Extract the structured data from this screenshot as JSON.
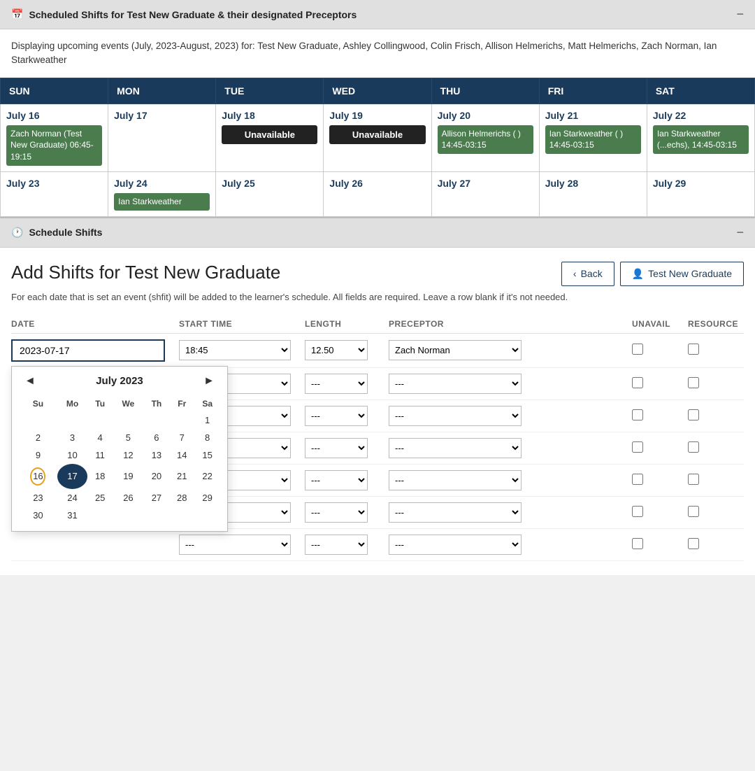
{
  "topSection": {
    "title": "Scheduled Shifts for Test New Graduate & their designated Preceptors",
    "minimize": "−",
    "displayText": "Displaying upcoming events (July, 2023-August, 2023) for: Test New Graduate, Ashley Collingwood, Colin Frisch, Allison Helmerichs, Matt Helmerichs, Zach Norman, Ian Starkweather"
  },
  "calendar": {
    "headers": [
      "SUN",
      "MON",
      "TUE",
      "WED",
      "THU",
      "FRI",
      "SAT"
    ],
    "weeks": [
      [
        {
          "date": "July 16",
          "events": [
            {
              "type": "event",
              "text": "Zach Norman (Test New Graduate) 06:45-19:15"
            }
          ]
        },
        {
          "date": "July 17",
          "events": []
        },
        {
          "date": "July 18",
          "events": [
            {
              "type": "unavail",
              "text": "Unavailable"
            }
          ]
        },
        {
          "date": "July 19",
          "events": [
            {
              "type": "unavail",
              "text": "Unavailable"
            }
          ]
        },
        {
          "date": "July 20",
          "events": [
            {
              "type": "event",
              "text": "Allison Helmerichs (\n) 14:45-03:15"
            }
          ]
        },
        {
          "date": "July 21",
          "events": [
            {
              "type": "event",
              "text": "Ian Starkweather (\n) 14:45-03:15"
            }
          ]
        },
        {
          "date": "July 22",
          "events": [
            {
              "type": "event",
              "text": "Ian Starkweather (...echs), 14:45-03:15"
            }
          ]
        }
      ],
      [
        {
          "date": "July 23",
          "events": []
        },
        {
          "date": "July 24",
          "events": [
            {
              "type": "event",
              "text": "Ian Starkweather"
            }
          ]
        },
        {
          "date": "July 25",
          "events": []
        },
        {
          "date": "July 26",
          "events": []
        },
        {
          "date": "July 27",
          "events": []
        },
        {
          "date": "July 28",
          "events": []
        },
        {
          "date": "July 29",
          "events": []
        }
      ]
    ]
  },
  "scheduleSection": {
    "title": "Schedule Shifts",
    "minimize": "−",
    "clockIcon": "🕐"
  },
  "addShifts": {
    "title": "Add Shifts for Test New Graduate",
    "backLabel": "‹ Back",
    "graduateLabel": "Test New Graduate",
    "desc": "For each date that is set an event (shfit) will be added to the learner's schedule. All fields are required. Leave a row blank if it's not needed.",
    "tableHeaders": {
      "date": "DATE",
      "startTime": "START TIME",
      "length": "LENGTH",
      "preceptor": "PRECEPTOR",
      "unavail": "UNAVAIL",
      "resource": "RESOURCE"
    },
    "firstRow": {
      "date": "2023-07-17",
      "startTime": "18:45",
      "length": "12.50",
      "preceptor": "Zach Norman"
    },
    "emptyRows": 6,
    "datepicker": {
      "monthLabel": "July 2023",
      "prevNav": "◄",
      "nextNav": "►",
      "dayHeaders": [
        "Su",
        "Mo",
        "Tu",
        "We",
        "Th",
        "Fr",
        "Sa"
      ],
      "weeks": [
        [
          "",
          "",
          "",
          "",
          "",
          "",
          "1"
        ],
        [
          "2",
          "3",
          "4",
          "5",
          "6",
          "7",
          "8"
        ],
        [
          "9",
          "10",
          "11",
          "12",
          "13",
          "14",
          "15"
        ],
        [
          "16",
          "17",
          "18",
          "19",
          "20",
          "21",
          "22"
        ],
        [
          "23",
          "24",
          "25",
          "26",
          "27",
          "28",
          "29"
        ],
        [
          "30",
          "31",
          "",
          "",
          "",
          "",
          ""
        ]
      ],
      "today": "16",
      "selected": "17"
    }
  }
}
